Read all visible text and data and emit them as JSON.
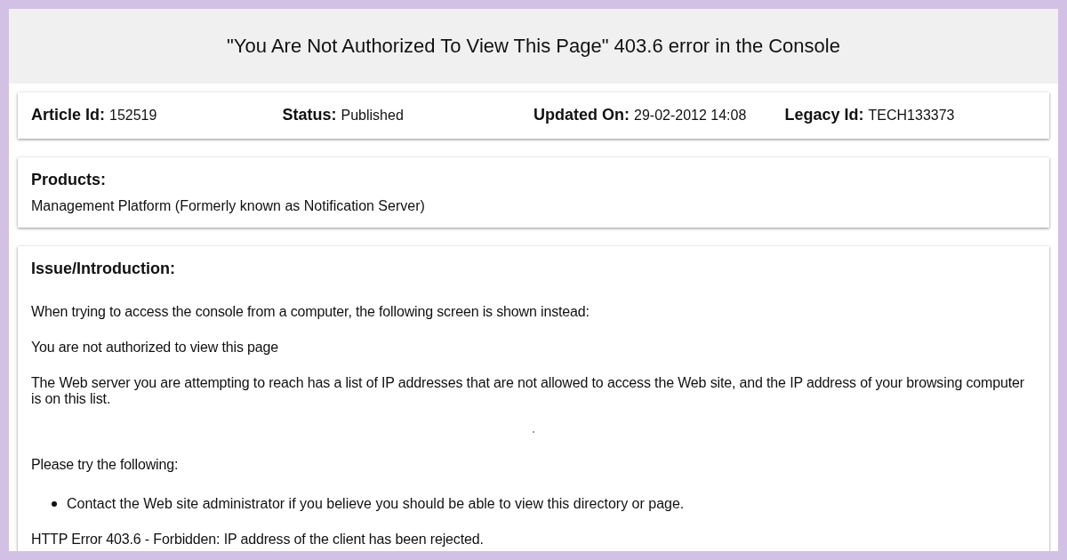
{
  "page": {
    "title": "\"You Are Not Authorized To View This Page\" 403.6 error in the Console"
  },
  "meta": [
    {
      "label": "Article Id:",
      "value": "152519"
    },
    {
      "label": "Status:",
      "value": "Published"
    },
    {
      "label": "Updated On:",
      "value": "29-02-2012 14:08"
    },
    {
      "label": "Legacy Id:",
      "value": "TECH133373"
    }
  ],
  "products": {
    "heading": "Products:",
    "items": [
      "Management Platform (Formerly known as Notification Server)"
    ]
  },
  "issue": {
    "heading": "Issue/Introduction:",
    "blocks": [
      {
        "kind": "paragraph",
        "text": "When trying to access the console from a computer, the following screen is shown instead:"
      },
      {
        "kind": "paragraph",
        "text": "You are not authorized to view this page"
      },
      {
        "kind": "paragraph",
        "text": "The Web server you are attempting to reach has a list of IP addresses that are not allowed to access the Web site, and the IP address of your browsing computer is on this list."
      },
      {
        "kind": "image"
      },
      {
        "kind": "paragraph",
        "text": "Please try the following:"
      },
      {
        "kind": "list",
        "items": [
          "Contact the Web site administrator if you believe you should be able to view this directory or page."
        ]
      },
      {
        "kind": "paragraph",
        "text": "HTTP Error 403.6 - Forbidden: IP address of the client has been rejected."
      }
    ]
  }
}
